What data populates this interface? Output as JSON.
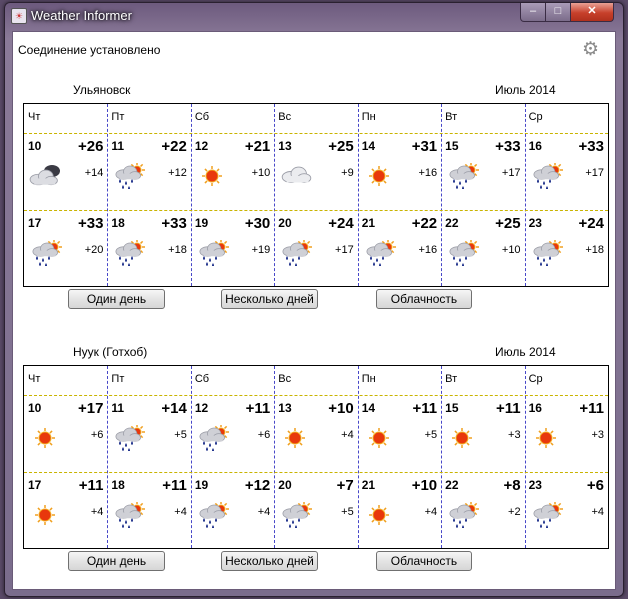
{
  "window": {
    "title": "Weather Informer",
    "controls": {
      "minimize": "–",
      "maximize": "□",
      "close": "✕"
    }
  },
  "status": "Соединение установлено",
  "weekdays": [
    "Чт",
    "Пт",
    "Сб",
    "Вс",
    "Пн",
    "Вт",
    "Ср"
  ],
  "buttons": {
    "one_day": "Один день",
    "several_days": "Несколько дней",
    "clouds": "Облачность"
  },
  "locations": [
    {
      "city": "Ульяновск",
      "month": "Июль 2014",
      "days": [
        {
          "day": "10",
          "max": "+26",
          "min": "+14",
          "icon": "cloudy-night"
        },
        {
          "day": "11",
          "max": "+22",
          "min": "+12",
          "icon": "rain-sun"
        },
        {
          "day": "12",
          "max": "+21",
          "min": "+10",
          "icon": "sun"
        },
        {
          "day": "13",
          "max": "+25",
          "min": "+9",
          "icon": "cloud"
        },
        {
          "day": "14",
          "max": "+31",
          "min": "+16",
          "icon": "sun"
        },
        {
          "day": "15",
          "max": "+33",
          "min": "+17",
          "icon": "rain-sun"
        },
        {
          "day": "16",
          "max": "+33",
          "min": "+17",
          "icon": "rain-sun"
        },
        {
          "day": "17",
          "max": "+33",
          "min": "+20",
          "icon": "rain-sun"
        },
        {
          "day": "18",
          "max": "+33",
          "min": "+18",
          "icon": "rain-sun"
        },
        {
          "day": "19",
          "max": "+30",
          "min": "+19",
          "icon": "rain-sun"
        },
        {
          "day": "20",
          "max": "+24",
          "min": "+17",
          "icon": "rain-sun"
        },
        {
          "day": "21",
          "max": "+22",
          "min": "+16",
          "icon": "rain-sun"
        },
        {
          "day": "22",
          "max": "+25",
          "min": "+10",
          "icon": "rain-sun"
        },
        {
          "day": "23",
          "max": "+24",
          "min": "+18",
          "icon": "rain-sun"
        }
      ]
    },
    {
      "city": "Нуук (Готхоб)",
      "month": "Июль 2014",
      "days": [
        {
          "day": "10",
          "max": "+17",
          "min": "+6",
          "icon": "sun"
        },
        {
          "day": "11",
          "max": "+14",
          "min": "+5",
          "icon": "rain-sun"
        },
        {
          "day": "12",
          "max": "+11",
          "min": "+6",
          "icon": "rain-sun"
        },
        {
          "day": "13",
          "max": "+10",
          "min": "+4",
          "icon": "sun"
        },
        {
          "day": "14",
          "max": "+11",
          "min": "+5",
          "icon": "sun"
        },
        {
          "day": "15",
          "max": "+11",
          "min": "+3",
          "icon": "sun"
        },
        {
          "day": "16",
          "max": "+11",
          "min": "+3",
          "icon": "sun"
        },
        {
          "day": "17",
          "max": "+11",
          "min": "+4",
          "icon": "sun"
        },
        {
          "day": "18",
          "max": "+11",
          "min": "+4",
          "icon": "rain-sun"
        },
        {
          "day": "19",
          "max": "+12",
          "min": "+4",
          "icon": "rain-sun"
        },
        {
          "day": "20",
          "max": "+7",
          "min": "+5",
          "icon": "rain-sun"
        },
        {
          "day": "21",
          "max": "+10",
          "min": "+4",
          "icon": "sun"
        },
        {
          "day": "22",
          "max": "+8",
          "min": "+2",
          "icon": "rain-sun"
        },
        {
          "day": "23",
          "max": "+6",
          "min": "+4",
          "icon": "rain-sun"
        }
      ]
    }
  ],
  "colors": {
    "sun": "#e8380c",
    "rain": "#1c2f8a",
    "cloud": "#cfd0d6",
    "accent_grid": "#4747c8"
  }
}
